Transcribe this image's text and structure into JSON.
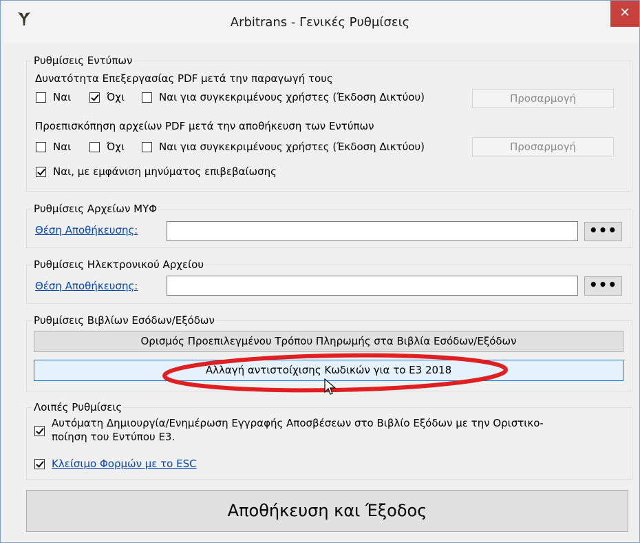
{
  "window": {
    "title": "Arbitrans - Γενικές Ρυθμίσεις",
    "close_glyph": "✕"
  },
  "forms_settings": {
    "legend": "Ρυθμίσεις Εντύπων",
    "edit_pdf_label": "Δυνατότητα Επεξεργασίας PDF μετά την παραγωγή τους",
    "edit_pdf_options": {
      "yes": "Ναι",
      "no": "Όχι",
      "specific": "Ναι για συγκεκριμένους χρήστες (Έκδοση Δικτύου)",
      "no_checked": true
    },
    "customize_label": "Προσαρμογή",
    "preview_pdf_label": "Προεπισκόπηση αρχείων PDF μετά την αποθήκευση των Εντύπων",
    "preview_pdf_options": {
      "yes": "Ναι",
      "no": "Όχι",
      "specific": "Ναι για συγκεκριμένους χρήστες (Έκδοση Δικτύου)"
    },
    "confirm_label": "Ναι, με εμφάνιση μηνύματος επιβεβαίωσης",
    "confirm_checked": true
  },
  "myf_settings": {
    "legend": "Ρυθμίσεις Αρχείων ΜΥΦ",
    "location_label": "Θέση Αποθήκευσης:",
    "value": "",
    "browse": "•••"
  },
  "electronic_settings": {
    "legend": "Ρυθμίσεις Ηλεκτρονικού Αρχείου",
    "location_label": "Θέση Αποθήκευσης:",
    "value": "",
    "browse": "•••"
  },
  "books_settings": {
    "legend": "Ρυθμίσεις Βιβλίων Εσόδων/Εξόδων",
    "payment_button": "Ορισμός Προεπιλεγμένου Τρόπου Πληρωμής στα Βιβλία Εσόδων/Εξόδων",
    "e3_button": "Αλλαγή αντιστοίχισης Κωδικών για το Ε3 2018"
  },
  "other_settings": {
    "legend": "Λοιπές Ρυθμίσεις",
    "depreciation_line1": "Αυτόματη Δημιουργία/Ενημέρωση Εγγραφής Αποσβέσεων στο Βιβλίο Εξόδων με την Οριστικο-",
    "depreciation_line2": "ποίηση του Εντύπου Ε3.",
    "depreciation_checked": true,
    "esc_label": "Κλείσιμο Φορμών με το ESC",
    "esc_checked": true
  },
  "save_button": "Αποθήκευση και Έξοδος",
  "colors": {
    "highlight_ellipse": "#e02020",
    "close_button": "#c8423c",
    "link": "#0645ad"
  }
}
